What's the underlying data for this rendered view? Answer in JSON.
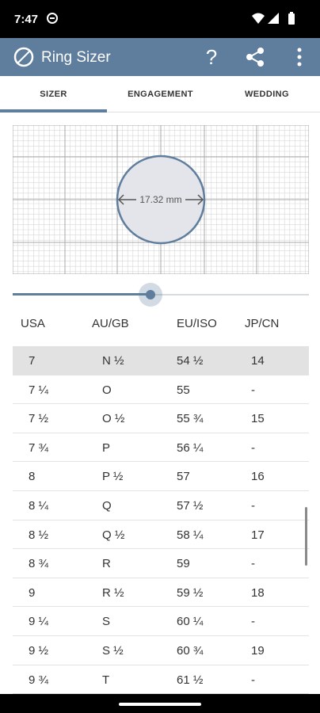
{
  "status": {
    "time": "7:47"
  },
  "app": {
    "title": "Ring Sizer",
    "help_label": "?"
  },
  "tabs": [
    {
      "label": "SIZER"
    },
    {
      "label": "ENGAGEMENT"
    },
    {
      "label": "WEDDING"
    }
  ],
  "sizer": {
    "measurement": "17.32 mm"
  },
  "slider": {
    "value_fraction": 0.465
  },
  "table": {
    "headers": [
      "USA",
      "AU/GB",
      "EU/ISO",
      "JP/CN"
    ],
    "rows": [
      [
        "7",
        "N ½",
        "54 ½",
        "14"
      ],
      [
        "7 ¼",
        "O",
        "55",
        "-"
      ],
      [
        "7 ½",
        "O ½",
        "55 ¾",
        "15"
      ],
      [
        "7 ¾",
        "P",
        "56 ¼",
        "-"
      ],
      [
        "8",
        "P ½",
        "57",
        "16"
      ],
      [
        "8 ¼",
        "Q",
        "57 ½",
        "-"
      ],
      [
        "8 ½",
        "Q ½",
        "58 ¼",
        "17"
      ],
      [
        "8 ¾",
        "R",
        "59",
        "-"
      ],
      [
        "9",
        "R ½",
        "59 ½",
        "18"
      ],
      [
        "9 ¼",
        "S",
        "60 ¼",
        "-"
      ],
      [
        "9 ½",
        "S ½",
        "60 ¾",
        "19"
      ],
      [
        "9 ¾",
        "T",
        "61 ½",
        "-"
      ]
    ]
  },
  "colors": {
    "accent": "#5f7d9c",
    "selected_row": "#e2e2e2",
    "circle_fill": "#e3e5ea"
  }
}
